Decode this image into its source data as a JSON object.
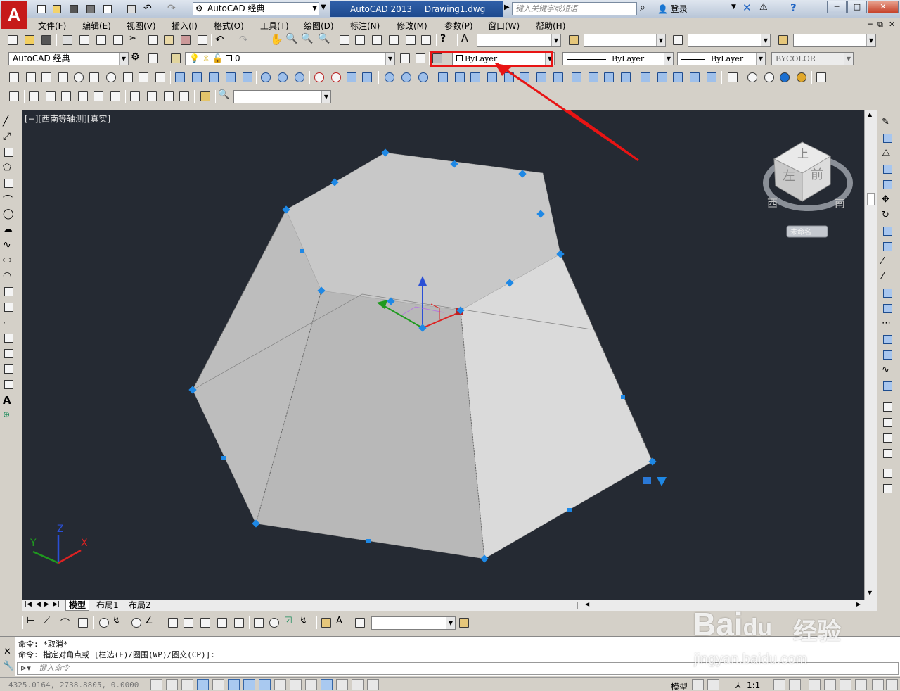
{
  "window": {
    "app_title": "AutoCAD 2013",
    "document_title": "Drawing1.dwg",
    "workspace": "AutoCAD 经典",
    "search_placeholder": "键入关键字或短语",
    "login_label": "登录",
    "minimize": "─",
    "maximize": "□",
    "close": "✕"
  },
  "menus": [
    {
      "label": "文件(F)"
    },
    {
      "label": "编辑(E)"
    },
    {
      "label": "视图(V)"
    },
    {
      "label": "插入(I)"
    },
    {
      "label": "格式(O)"
    },
    {
      "label": "工具(T)"
    },
    {
      "label": "绘图(D)"
    },
    {
      "label": "标注(N)"
    },
    {
      "label": "修改(M)"
    },
    {
      "label": "参数(P)"
    },
    {
      "label": "窗口(W)"
    },
    {
      "label": "帮助(H)"
    }
  ],
  "mdi_controls": [
    "─",
    "⧉",
    "✕"
  ],
  "properties": {
    "workspace_combo": "AutoCAD 经典",
    "layer_value": "0",
    "color_value": "ByLayer",
    "linetype_value": "ByLayer",
    "lineweight_value": "ByLayer",
    "plotstyle_value": "BYCOLOR"
  },
  "viewport": {
    "label": "[−][西南等轴测][真实]",
    "background": "#252a33",
    "viewcube": {
      "top": "上",
      "left": "左",
      "front": "前",
      "west": "西",
      "south": "南",
      "unnamed": "未命名"
    },
    "ucs_x": "X",
    "ucs_y": "Y",
    "ucs_z": "Z",
    "grip_color": "#1e88e5",
    "annotation_color": "#e81414"
  },
  "layout_tabs": [
    "模型",
    "布局1",
    "布局2"
  ],
  "command": {
    "history": [
      "命令: *取消*",
      "命令: 指定对角点或 [栏选(F)/圈围(WP)/圈交(CP)]:"
    ],
    "placeholder": "键入命令"
  },
  "status": {
    "coords": "4325.0164, 2738.8805, 0.0000",
    "model_label": "模型",
    "scale_label": "1:1"
  },
  "watermark": {
    "brand": "Bai",
    "paw": "du",
    "suffix": "经验",
    "url": "jingyan.baidu.com"
  }
}
